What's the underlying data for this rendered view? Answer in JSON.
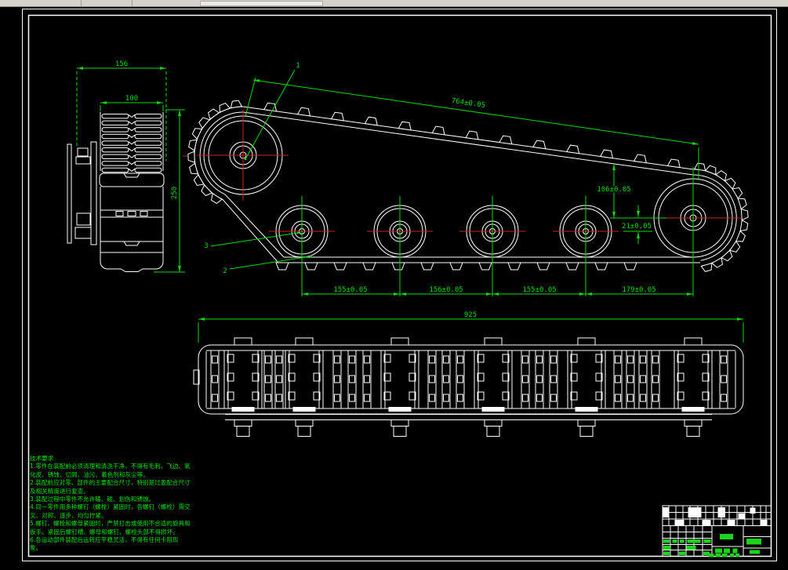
{
  "drawing": {
    "callouts": {
      "c1": "1",
      "c2": "2",
      "c3": "3"
    },
    "front_view_dims": {
      "overall_width": "156",
      "tread_width": "100",
      "height": "250"
    },
    "side_view_dims": {
      "belt_span": "764±0.05",
      "height_drop": "106±0.05",
      "center_offset": "21±0.05",
      "spacing_1": "155±0.05",
      "spacing_2": "156±0.05",
      "spacing_3": "155±0.05",
      "spacing_4": "179±0.05"
    },
    "bottom_view_dims": {
      "overall_length": "925"
    },
    "notes": {
      "title": "技术要求",
      "lines": [
        "1.零件在装配前必须清理和清洗干净，不得有毛刺、飞边、氧",
        "化皮、锈蚀、切屑、油污、着色剂和灰尘等。",
        "2.装配前应对零、部件的主要配合尺寸，特别是过盈配合尺寸",
        "及相关精度进行复查。",
        "3.装配过程中零件不允许磕、碰、划伤和锈蚀。",
        "4.同一零件用多种螺钉（螺栓）紧固时，各螺钉（螺栓）需交",
        "叉、对称、逐步、均匀拧紧。",
        "5.螺钉、螺栓和螺母紧固时，严禁打击或使用不合适的旋具和",
        "扳手。紧固后螺钉槽、螺母和螺钉、螺栓头部不得损坏。",
        "6.各运动部件装配后运转应平稳灵活，不得有任何卡阻现",
        "象。"
      ]
    },
    "colors": {
      "background": "#000000",
      "geometry": "#ffffff",
      "dimension": "#00dd00",
      "centerline": "#cc2222",
      "note_text": "#00e400",
      "title_block_text": "#19d419"
    }
  }
}
